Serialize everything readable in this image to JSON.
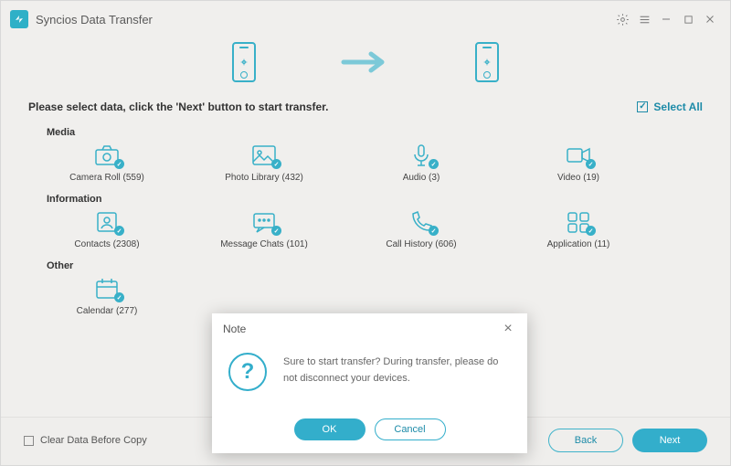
{
  "header": {
    "title": "Syncios Data Transfer"
  },
  "instruction": "Please select data, click the 'Next' button to start transfer.",
  "select_all": "Select All",
  "sections": {
    "media": {
      "label": "Media",
      "items": [
        {
          "label": "Camera Roll (559)"
        },
        {
          "label": "Photo Library (432)"
        },
        {
          "label": "Audio (3)"
        },
        {
          "label": "Video (19)"
        }
      ]
    },
    "information": {
      "label": "Information",
      "items": [
        {
          "label": "Contacts (2308)"
        },
        {
          "label": "Message Chats (101)"
        },
        {
          "label": "Call History (606)"
        },
        {
          "label": "Application (11)"
        }
      ]
    },
    "other": {
      "label": "Other",
      "items": [
        {
          "label": "Calendar (277)"
        }
      ]
    }
  },
  "footer": {
    "clear_label": "Clear Data Before Copy",
    "back": "Back",
    "next": "Next"
  },
  "modal": {
    "title": "Note",
    "message": "Sure to start transfer? During transfer, please do not disconnect your devices.",
    "ok": "OK",
    "cancel": "Cancel"
  },
  "colors": {
    "accent": "#33aecb"
  }
}
